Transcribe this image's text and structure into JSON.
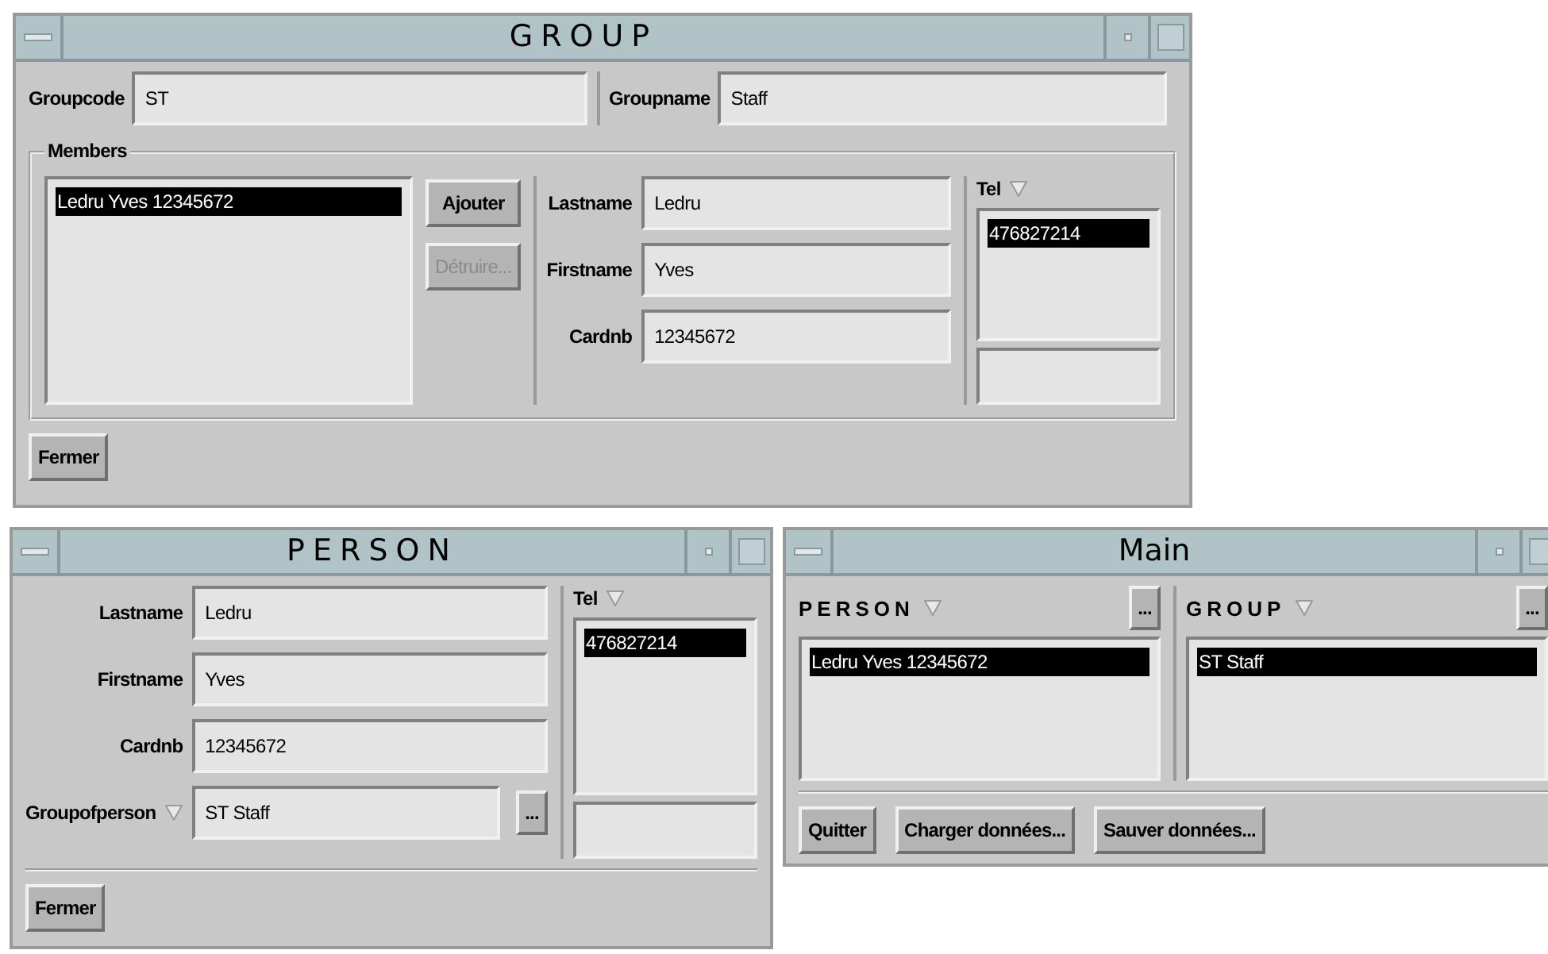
{
  "group_window": {
    "title": "GROUP",
    "groupcode": {
      "label": "Groupcode",
      "value": "ST"
    },
    "groupname": {
      "label": "Groupname",
      "value": "Staff"
    },
    "members": {
      "legend": "Members",
      "items": [
        {
          "text": "Ledru Yves 12345672",
          "selected": true
        }
      ],
      "buttons": [
        {
          "label": "Ajouter",
          "disabled": false
        },
        {
          "label": "Détruire...",
          "disabled": true
        }
      ],
      "fields": [
        {
          "label": "Lastname",
          "value": "Ledru"
        },
        {
          "label": "Firstname",
          "value": "Yves"
        },
        {
          "label": "Cardnb",
          "value": "12345672"
        }
      ],
      "tel": {
        "label": "Tel",
        "items": [
          {
            "text": "476827214",
            "selected": true
          }
        ]
      }
    },
    "close_button": "Fermer"
  },
  "person_window": {
    "title": "PERSON",
    "fields": [
      {
        "label": "Lastname",
        "value": "Ledru"
      },
      {
        "label": "Firstname",
        "value": "Yves"
      },
      {
        "label": "Cardnb",
        "value": "12345672"
      }
    ],
    "group_of_person": {
      "label": "Groupofperson",
      "value": "ST Staff",
      "more_button": "..."
    },
    "tel": {
      "label": "Tel",
      "items": [
        {
          "text": "476827214",
          "selected": true
        }
      ]
    },
    "close_button": "Fermer"
  },
  "main_window": {
    "title": "Main",
    "panels": [
      {
        "label": "PERSON",
        "more_button": "...",
        "items": [
          {
            "text": "Ledru Yves 12345672",
            "selected": true
          }
        ]
      },
      {
        "label": "GROUP",
        "more_button": "...",
        "items": [
          {
            "text": "ST Staff",
            "selected": true
          }
        ]
      }
    ],
    "buttons": [
      "Quitter",
      "Charger données...",
      "Sauver données..."
    ]
  }
}
